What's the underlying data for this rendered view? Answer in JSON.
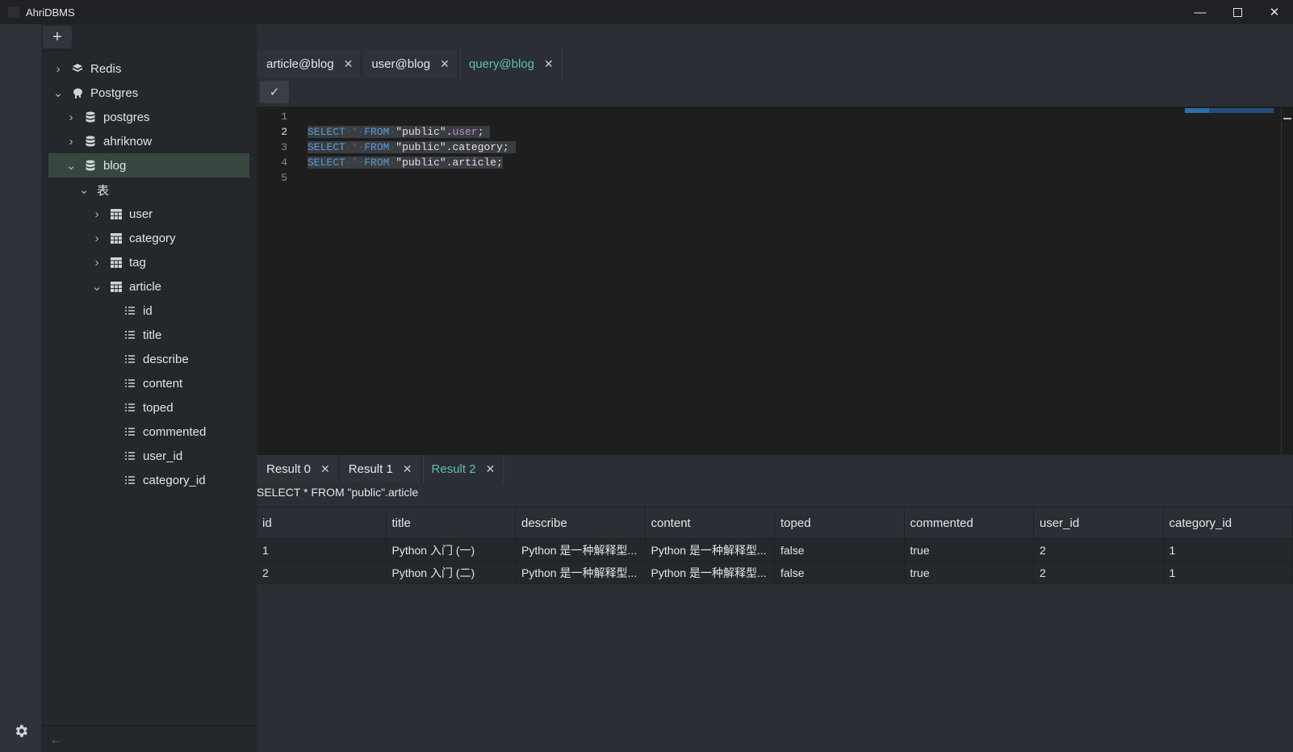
{
  "app": {
    "title": "AhriDBMS"
  },
  "tree": {
    "redis": "Redis",
    "postgres": "Postgres",
    "db_postgres": "postgres",
    "db_ahriknow": "ahriknow",
    "db_blog": "blog",
    "tables_group": "表",
    "tables": [
      "user",
      "category",
      "tag",
      "article"
    ],
    "columns": [
      "id",
      "title",
      "describe",
      "content",
      "toped",
      "commented",
      "user_id",
      "category_id"
    ]
  },
  "tabs": [
    "article@blog",
    "user@blog",
    "query@blog"
  ],
  "editor": {
    "line_numbers": [
      "1",
      "2",
      "3",
      "4",
      "5"
    ],
    "lines": [
      {
        "kw1": "SELECT",
        "star": "*",
        "kw2": "FROM",
        "schema": "\"public\".",
        "table": "user",
        "end": ";"
      },
      {
        "kw1": "SELECT",
        "star": "*",
        "kw2": "FROM",
        "schema": "\"public\".",
        "table": "category",
        "end": ";"
      },
      {
        "kw1": "SELECT",
        "star": "*",
        "kw2": "FROM",
        "schema": "\"public\".",
        "table": "article",
        "end": ";"
      }
    ]
  },
  "result_tabs": [
    "Result 0",
    "Result 1",
    "Result 2"
  ],
  "result": {
    "query": "SELECT * FROM \"public\".article",
    "columns": [
      "id",
      "title",
      "describe",
      "content",
      "toped",
      "commented",
      "user_id",
      "category_id"
    ],
    "rows": [
      [
        "1",
        "Python 入门 (一)",
        "Python 是一种解释型...",
        "Python 是一种解释型...",
        "false",
        "true",
        "2",
        "1"
      ],
      [
        "2",
        "Python 入门 (二)",
        "Python 是一种解释型...",
        "Python 是一种解释型...",
        "false",
        "true",
        "2",
        "1"
      ]
    ]
  },
  "colors": {
    "accent": "#5cc5a3",
    "selection": "#36473f",
    "keyword": "#569cd6",
    "highlight": "#c586c0"
  }
}
